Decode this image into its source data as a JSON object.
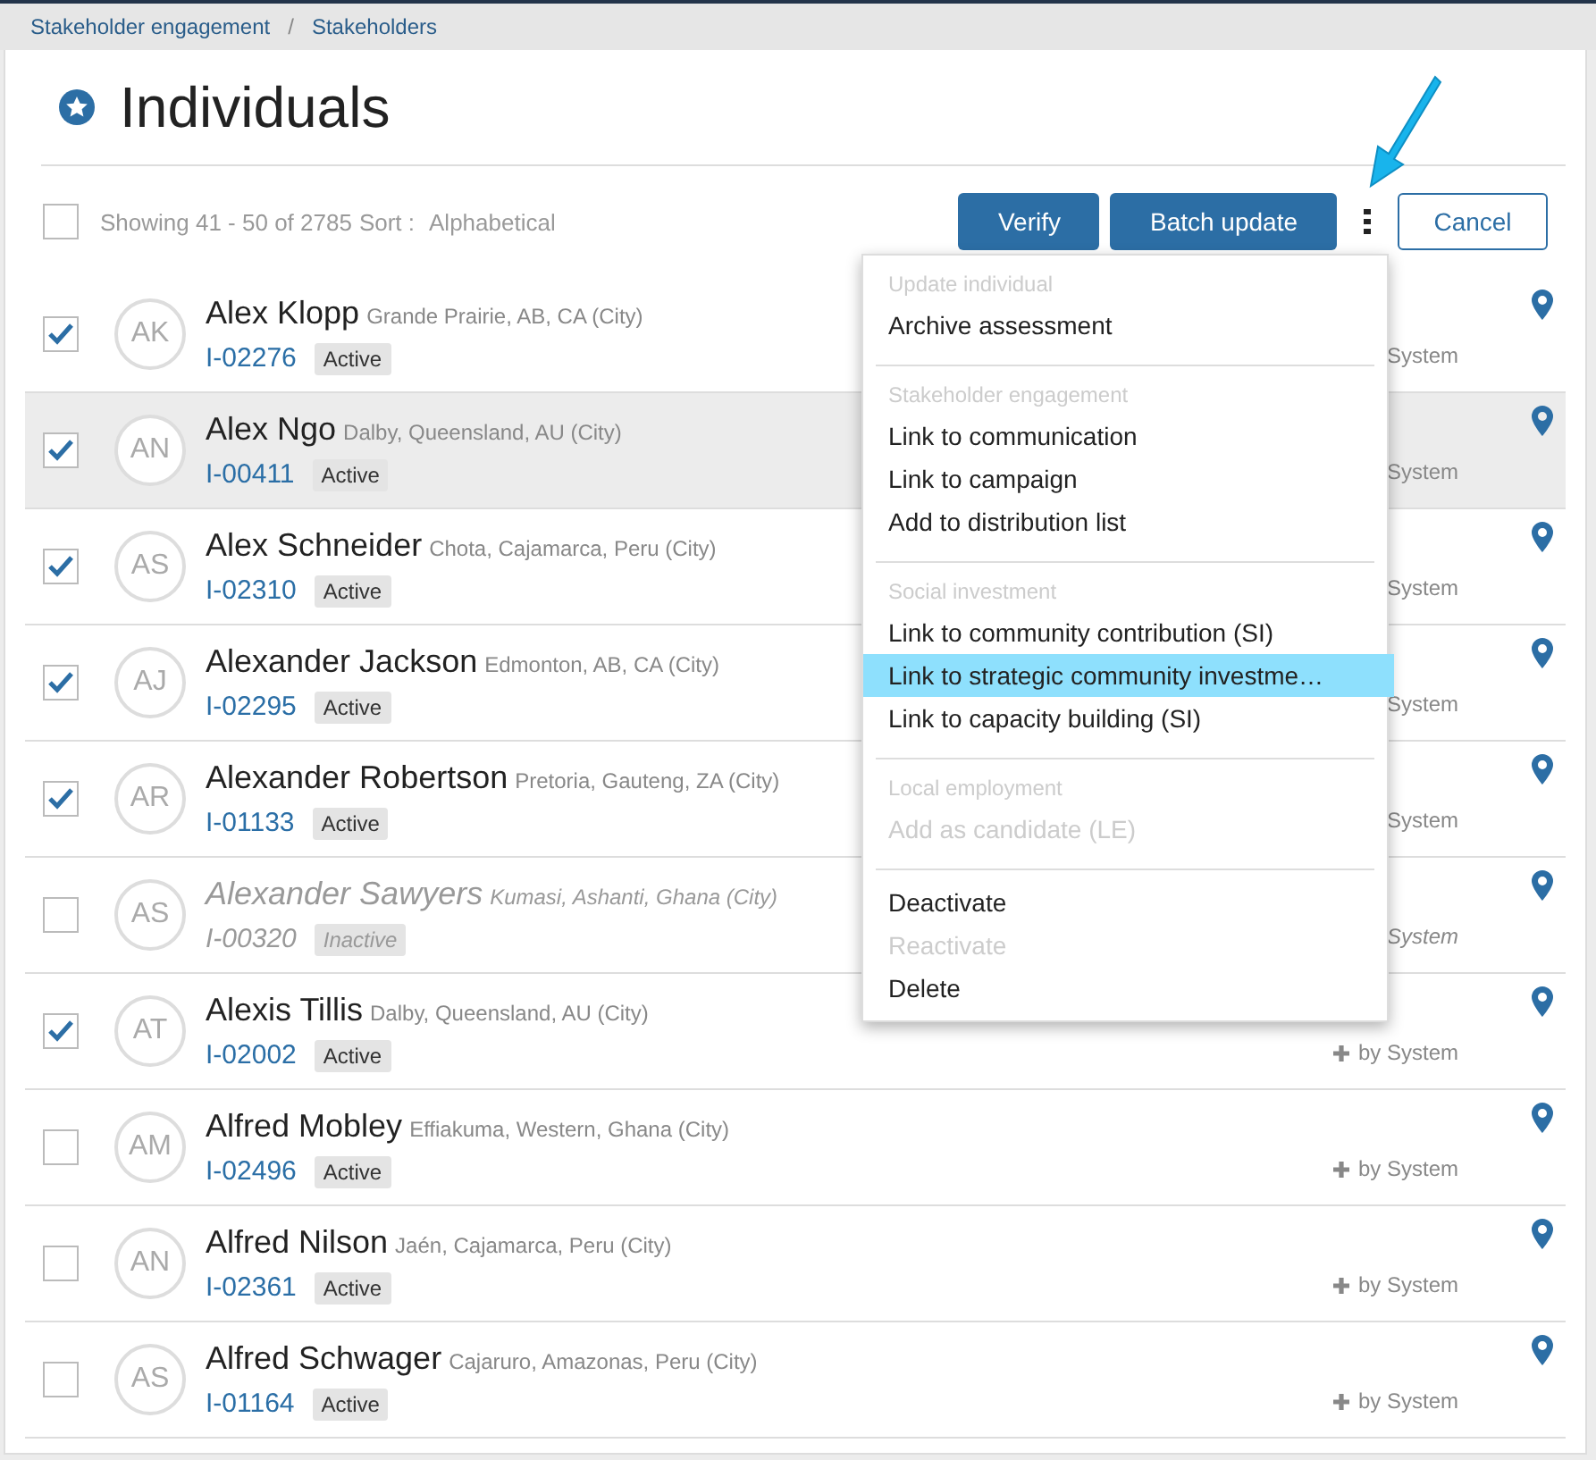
{
  "breadcrumb": [
    "Stakeholder engagement",
    "Stakeholders"
  ],
  "breadcrumb_separator": "/",
  "title": "Individuals",
  "toolbar": {
    "select_all": {
      "checked": false
    },
    "showing": "Showing 41 - 50 of 2785",
    "sort_label": "Sort :",
    "sort_value": "Alphabetical",
    "buttons": [
      "Verify",
      "Batch update"
    ],
    "cancel": "Cancel"
  },
  "rows": [
    {
      "initials": "AK",
      "name": "Alex Klopp",
      "location": "Grande Prairie, AB, CA (City)",
      "id": "I-02276",
      "status": "Active",
      "active": true,
      "checked": true,
      "hovered": false,
      "creator": "System"
    },
    {
      "initials": "AN",
      "name": "Alex Ngo",
      "location": "Dalby, Queensland, AU (City)",
      "id": "I-00411",
      "status": "Active",
      "active": true,
      "checked": true,
      "hovered": true,
      "creator": "System"
    },
    {
      "initials": "AS",
      "name": "Alex Schneider",
      "location": "Chota, Cajamarca, Peru (City)",
      "id": "I-02310",
      "status": "Active",
      "active": true,
      "checked": true,
      "hovered": false,
      "creator": "System"
    },
    {
      "initials": "AJ",
      "name": "Alexander Jackson",
      "location": "Edmonton, AB, CA (City)",
      "id": "I-02295",
      "status": "Active",
      "active": true,
      "checked": true,
      "hovered": false,
      "creator": "System"
    },
    {
      "initials": "AR",
      "name": "Alexander Robertson",
      "location": "Pretoria, Gauteng, ZA (City)",
      "id": "I-01133",
      "status": "Active",
      "active": true,
      "checked": true,
      "hovered": false,
      "creator": "System"
    },
    {
      "initials": "AS",
      "name": "Alexander Sawyers",
      "location": "Kumasi, Ashanti, Ghana (City)",
      "id": "I-00320",
      "status": "Inactive",
      "active": false,
      "checked": false,
      "hovered": false,
      "creator": "System"
    },
    {
      "initials": "AT",
      "name": "Alexis Tillis",
      "location": "Dalby, Queensland, AU (City)",
      "id": "I-02002",
      "status": "Active",
      "active": true,
      "checked": true,
      "hovered": false,
      "creator": "by System",
      "plus": true
    },
    {
      "initials": "AM",
      "name": "Alfred Mobley",
      "location": "Effiakuma, Western, Ghana (City)",
      "id": "I-02496",
      "status": "Active",
      "active": true,
      "checked": false,
      "hovered": false,
      "creator": "by System",
      "plus": true
    },
    {
      "initials": "AN",
      "name": "Alfred Nilson",
      "location": "Jaén, Cajamarca, Peru (City)",
      "id": "I-02361",
      "status": "Active",
      "active": true,
      "checked": false,
      "hovered": false,
      "creator": "by System",
      "plus": true
    },
    {
      "initials": "AS",
      "name": "Alfred Schwager",
      "location": "Cajaruro, Amazonas, Peru (City)",
      "id": "I-01164",
      "status": "Active",
      "active": true,
      "checked": false,
      "hovered": false,
      "creator": "by System",
      "plus": true
    }
  ],
  "menu": [
    {
      "header": "Update individual",
      "items": [
        {
          "label": "Archive assessment",
          "disabled": false,
          "selected": false
        }
      ]
    },
    {
      "header": "Stakeholder engagement",
      "items": [
        {
          "label": "Link to communication",
          "disabled": false,
          "selected": false
        },
        {
          "label": "Link to campaign",
          "disabled": false,
          "selected": false
        },
        {
          "label": "Add to distribution list",
          "disabled": false,
          "selected": false
        }
      ]
    },
    {
      "header": "Social investment",
      "items": [
        {
          "label": "Link to community contribution (SI)",
          "disabled": false,
          "selected": false
        },
        {
          "label": "Link to strategic community investme…",
          "disabled": false,
          "selected": true
        },
        {
          "label": "Link to capacity building (SI)",
          "disabled": false,
          "selected": false
        }
      ]
    },
    {
      "header": "Local employment",
      "items": [
        {
          "label": "Add as candidate (LE)",
          "disabled": true,
          "selected": false
        }
      ]
    },
    {
      "items": [
        {
          "label": "Deactivate",
          "disabled": false,
          "selected": false
        },
        {
          "label": "Reactivate",
          "disabled": true,
          "selected": false
        },
        {
          "label": "Delete",
          "disabled": false,
          "selected": false
        }
      ]
    }
  ]
}
